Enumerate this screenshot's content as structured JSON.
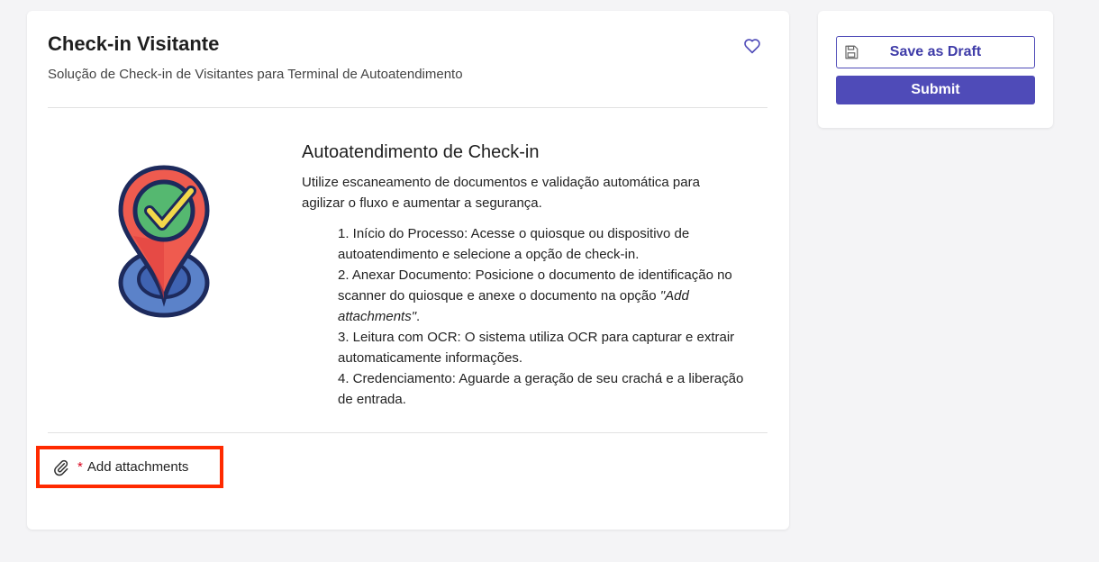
{
  "card": {
    "title": "Check-in Visitante",
    "subtitle": "Solução de Check-in de Visitantes para Terminal de Autoatendimento"
  },
  "content": {
    "section_title": "Autoatendimento de Check-in",
    "intro": "Utilize escaneamento de documentos e validação automática para agilizar o fluxo e aumentar a segurança.",
    "steps": [
      "1. Início do Processo: Acesse o quiosque ou dispositivo de autoatendimento e selecione a opção de check-in.",
      "2. Anexar Documento: Posicione o documento de identificação no scanner do quiosque e anexe o documento na opção ",
      "3. Leitura com OCR: O sistema utiliza OCR para capturar e extrair automaticamente informações.",
      "4. Credenciamento: Aguarde a geração de seu crachá e a liberação de entrada."
    ],
    "step2_emphasis": "\"Add attachments\"",
    "step2_suffix": "."
  },
  "attachments": {
    "required_mark": "*",
    "label": "Add attachments"
  },
  "actions": {
    "save_draft_label": "Save as Draft",
    "submit_label": "Submit"
  },
  "colors": {
    "primary": "#4f4bb8",
    "highlight": "#ff2a00",
    "required": "#d9001b"
  },
  "icons": {
    "favorite": "heart-outline-icon",
    "attach": "paperclip-icon",
    "save": "floppy-disk-icon",
    "illustration": "location-pin-check-icon"
  }
}
